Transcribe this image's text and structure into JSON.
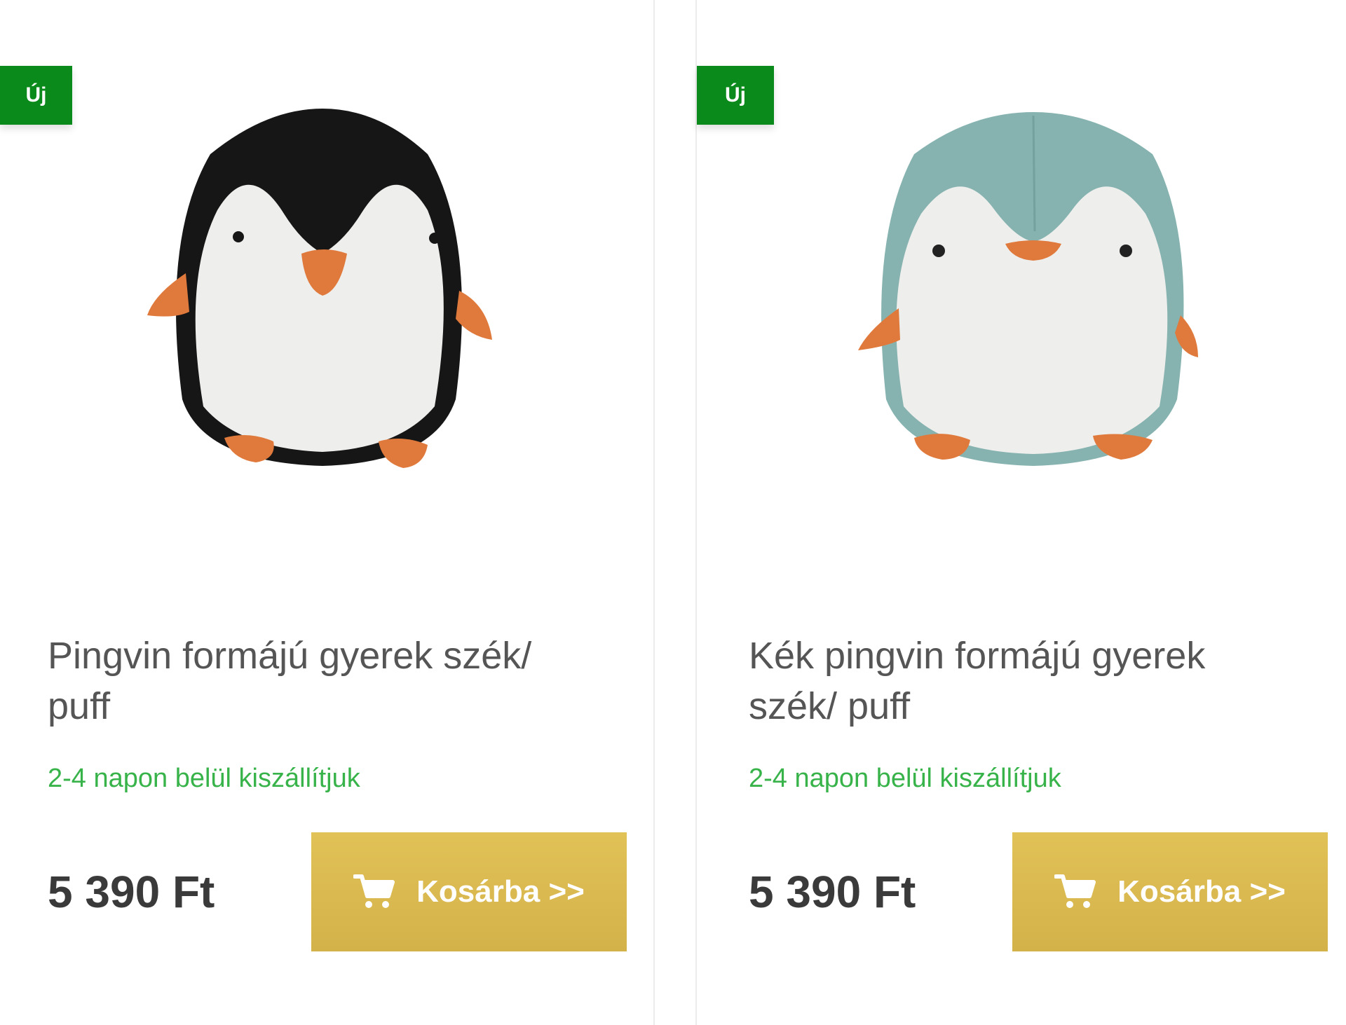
{
  "colors": {
    "badge_bg": "#0a8a1a",
    "shipping_text": "#37b34a",
    "button_bg": "#d9ba50",
    "price_text": "#3a3a3a",
    "title_text": "#555555"
  },
  "products": [
    {
      "badge": "Új",
      "image_icon": "black-penguin-pouf",
      "title": "Pingvin formájú gyerek szék/ puff",
      "shipping": "2-4 napon belül kiszállítjuk",
      "price": "5 390 Ft",
      "cart_label": "Kosárba >>",
      "cart_icon": "cart-icon"
    },
    {
      "badge": "Új",
      "image_icon": "blue-penguin-pouf",
      "title": "Kék pingvin formájú gyerek szék/ puff",
      "shipping": "2-4 napon belül kiszállítjuk",
      "price": "5 390 Ft",
      "cart_label": "Kosárba >>",
      "cart_icon": "cart-icon"
    }
  ]
}
